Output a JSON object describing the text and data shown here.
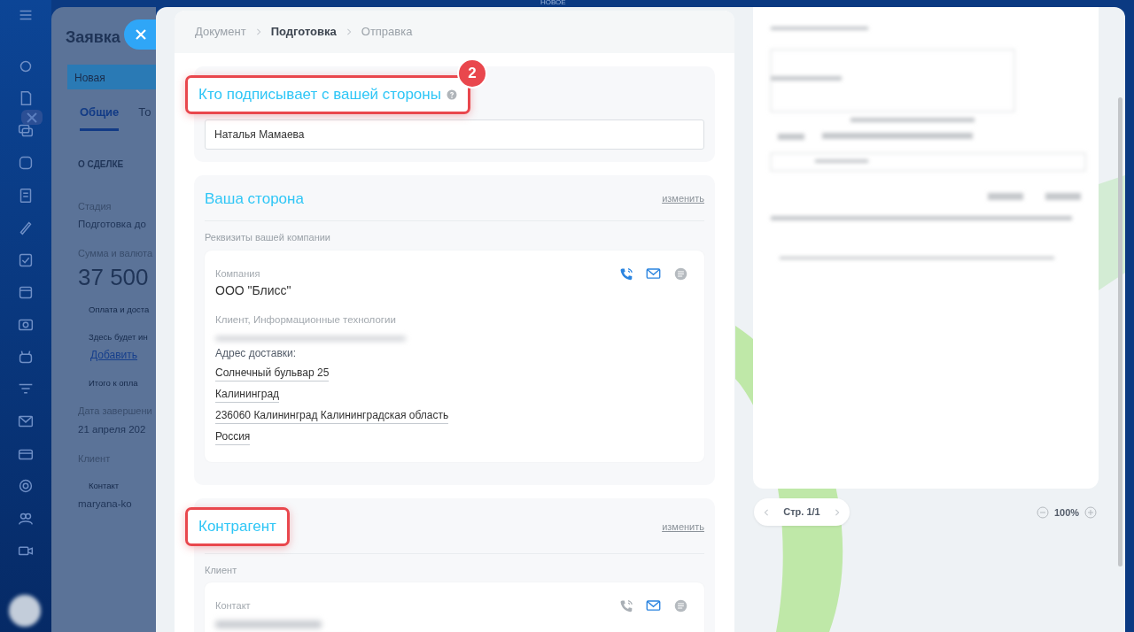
{
  "top_label": "НОВОЕ",
  "deal": {
    "title": "Заявка",
    "stage": "Новая",
    "tabs": [
      {
        "label": "Общие",
        "selected": true
      },
      {
        "label": "То",
        "selected": false
      }
    ],
    "section": "О СДЕЛКЕ",
    "fields": [
      {
        "kind": "label",
        "text": "Стадия"
      },
      {
        "kind": "value",
        "text": "Подготовка до"
      },
      {
        "kind": "label",
        "text": "Сумма и валюта"
      },
      {
        "kind": "big",
        "text": "37 500"
      },
      {
        "kind": "note",
        "text": "Оплата и доста"
      },
      {
        "kind": "note",
        "text": "Здесь будет ин"
      },
      {
        "kind": "link",
        "text": "Добавить"
      },
      {
        "kind": "note",
        "text": "Итого к опла"
      },
      {
        "kind": "label",
        "text": "Дата завершени"
      },
      {
        "kind": "value",
        "text": "21 апреля 202"
      },
      {
        "kind": "label",
        "text": "Клиент"
      },
      {
        "kind": "note",
        "text": "Контакт"
      },
      {
        "kind": "value",
        "text": "maryana-ko"
      }
    ]
  },
  "breadcrumbs": [
    {
      "label": "Документ",
      "selected": false
    },
    {
      "label": "Подготовка",
      "selected": true
    },
    {
      "label": "Отправка",
      "selected": false
    }
  ],
  "signer": {
    "title": "Кто подписывает с вашей стороны",
    "highlighted": true,
    "badge": "2",
    "value": "Наталья Мамаева"
  },
  "our_side": {
    "title": "Ваша сторона",
    "action": "изменить",
    "subtitle": "Реквизиты вашей компании",
    "card": {
      "type_label": "Компания",
      "name": "ООО \"Блисс\"",
      "description": "Клиент, Информационные технологии",
      "phone_active": true,
      "address_label": "Адрес доставки:",
      "address_lines": [
        "Солнечный бульвар 25",
        "Калининград",
        "236060 Калининград Калининградская область",
        "Россия"
      ]
    }
  },
  "counterparty": {
    "title": "Контрагент",
    "highlighted": true,
    "action": "изменить",
    "subtitle": "Клиент",
    "card": {
      "type_label": "Контакт",
      "phone_active": false
    }
  },
  "preview": {
    "pager": "Стр. 1/1",
    "zoom": "100%"
  }
}
